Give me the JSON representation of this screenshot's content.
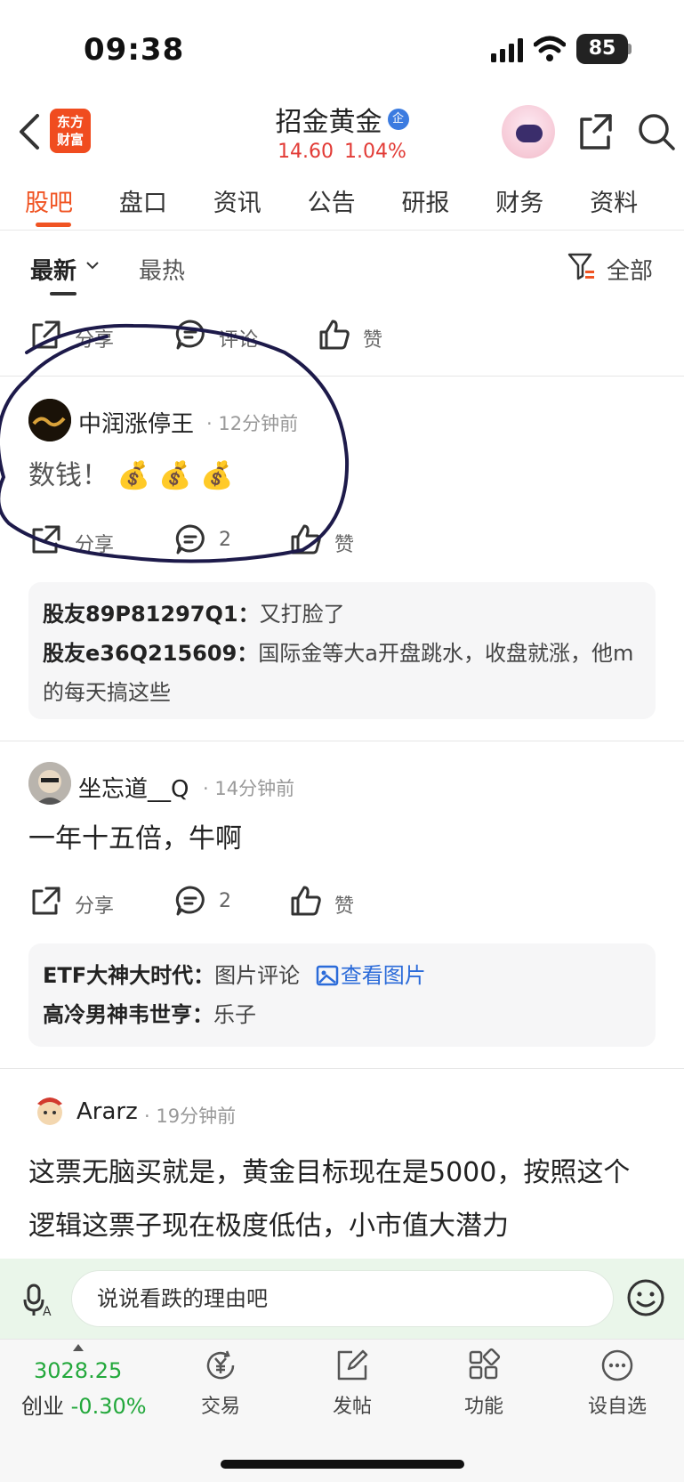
{
  "status": {
    "time": "09:38",
    "battery": "85"
  },
  "header": {
    "logo_text_1": "东方",
    "logo_text_2": "财富",
    "stock_name": "招金黄金",
    "badge": "企",
    "price": "14.60",
    "change": "1.04%"
  },
  "tabs": [
    "股吧",
    "盘口",
    "资讯",
    "公告",
    "研报",
    "财务",
    "资料"
  ],
  "filter": {
    "newest": "最新",
    "hottest": "最热",
    "all": "全部"
  },
  "actions": {
    "share": "分享",
    "comment": "评论",
    "like": "赞"
  },
  "posts": [
    {
      "author": "中润涨停王",
      "time": "12分钟前",
      "content": "数钱！ 💰 💰 💰",
      "comment_count": "2",
      "comments": [
        {
          "user": "股友89P81297Q1：",
          "text": "又打脸了"
        },
        {
          "user": "股友e36Q215609：",
          "text": "国际金等大a开盘跳水，收盘就涨，他m的每天搞这些"
        }
      ]
    },
    {
      "author": "坐忘道__Q",
      "time": "14分钟前",
      "content": "一年十五倍，牛啊",
      "comment_count": "2",
      "comments": [
        {
          "user": "ETF大神大时代：",
          "text": "图片评论",
          "link": "查看图片"
        },
        {
          "user": "高冷男神韦世亨：",
          "text": "乐子"
        }
      ]
    },
    {
      "author": "Ararz",
      "time": "19分钟前",
      "content": "这票无脑买就是，黄金目标现在是5000，按照这个逻辑这票子现在极度低估，小市值大潜力"
    }
  ],
  "input": {
    "placeholder": "说说看跌的理由吧"
  },
  "bottom_nav": {
    "index_value": "3028.25",
    "index_name": "创业",
    "index_change": "-0.30%",
    "items": [
      "交易",
      "发帖",
      "功能",
      "设自选"
    ]
  },
  "colors": {
    "accent": "#f05423",
    "up": "#e23b36",
    "down": "#23a83c",
    "link": "#2b6bd9"
  }
}
